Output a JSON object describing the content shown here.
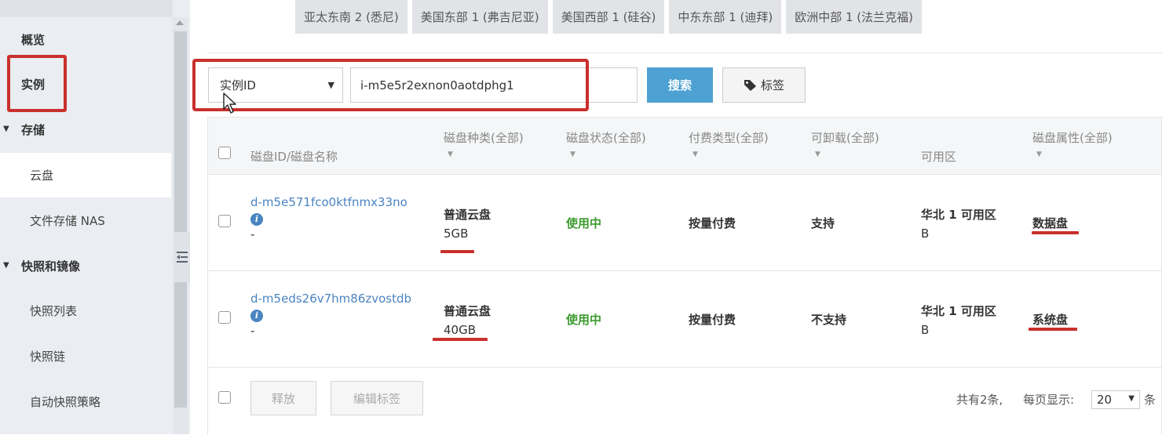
{
  "sidebar": {
    "items": [
      {
        "label": "概览",
        "kind": "top"
      },
      {
        "label": "实例",
        "kind": "top"
      },
      {
        "label": "存储",
        "kind": "section"
      },
      {
        "label": "云盘",
        "kind": "sub",
        "active": true
      },
      {
        "label": "文件存储 NAS",
        "kind": "sub"
      },
      {
        "label": "快照和镜像",
        "kind": "section"
      },
      {
        "label": "快照列表",
        "kind": "sub"
      },
      {
        "label": "快照链",
        "kind": "sub"
      },
      {
        "label": "自动快照策略",
        "kind": "sub"
      }
    ]
  },
  "regions": [
    "亚太东南 2 (悉尼)",
    "美国东部 1 (弗吉尼亚)",
    "美国西部 1 (硅谷)",
    "中东东部 1 (迪拜)",
    "欧洲中部 1 (法兰克福)"
  ],
  "search": {
    "field_selected": "实例ID",
    "value": "i-m5e5r2exnon0aotdphg1",
    "search_label": "搜索",
    "tag_label": "标签"
  },
  "table": {
    "headers": {
      "disk_id": "磁盘ID/磁盘名称",
      "type": "磁盘种类(全部)",
      "status": "磁盘状态(全部)",
      "billing": "付费类型(全部)",
      "detachable": "可卸载(全部)",
      "zone": "可用区",
      "attribute": "磁盘属性(全部)"
    },
    "rows": [
      {
        "id": "d-m5e571fco0ktfnmx33no",
        "name": "-",
        "type": "普通云盘",
        "size": "5GB",
        "status": "使用中",
        "billing": "按量付费",
        "detachable": "支持",
        "zone_line1": "华北 1 可用区",
        "zone_line2": "B",
        "attribute": "数据盘"
      },
      {
        "id": "d-m5eds26v7hm86zvostdb",
        "name": "-",
        "type": "普通云盘",
        "size": "40GB",
        "status": "使用中",
        "billing": "按量付费",
        "detachable": "不支持",
        "zone_line1": "华北 1 可用区",
        "zone_line2": "B",
        "attribute": "系统盘"
      }
    ],
    "footer": {
      "release_label": "释放",
      "edit_tags_label": "编辑标签",
      "total_text": "共有2条,",
      "per_page_text": "每页显示:",
      "per_page_value": "20",
      "per_page_suffix": "条"
    }
  },
  "icons": {
    "tag": "tag-icon",
    "info": "info-icon",
    "collapse": "collapse-sidebar-icon",
    "cursor": "mouse-cursor-icon"
  },
  "colors": {
    "accent_blue": "#4ea1d3",
    "link_blue": "#4a84c1",
    "status_green": "#3c9b2e",
    "annotation_red": "#c9302c"
  }
}
